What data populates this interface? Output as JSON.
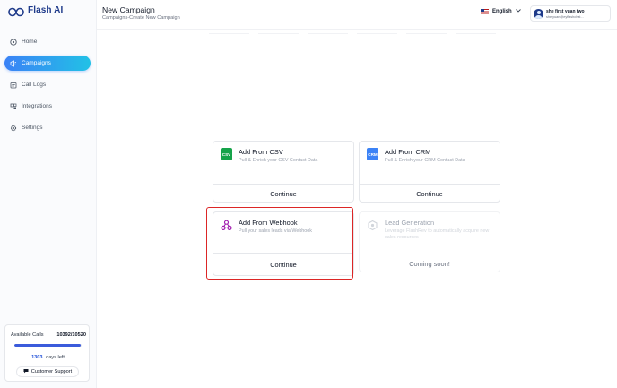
{
  "brand": {
    "name": "Flash AI",
    "accent": "#1e3a8a"
  },
  "sidebar": {
    "items": [
      {
        "label": "Home",
        "icon": "home-icon",
        "active": false
      },
      {
        "label": "Campaigns",
        "icon": "campaigns-icon",
        "active": true
      },
      {
        "label": "Call Logs",
        "icon": "call-logs-icon",
        "active": false
      },
      {
        "label": "Integrations",
        "icon": "integrations-icon",
        "active": false
      },
      {
        "label": "Settings",
        "icon": "gear-icon",
        "active": false
      }
    ],
    "usage": {
      "label": "Available Calls",
      "value": "10392/10520",
      "fraction": 0.988,
      "days_number": "1303",
      "days_label": "days left",
      "support_label": "Customer Support"
    }
  },
  "header": {
    "title": "New Campaign",
    "breadcrumb": "Campaigns-Create New Campaign",
    "language": "English",
    "user_name": "she first yuan two",
    "user_email": "she.yuan@eyflashchat..."
  },
  "cards": [
    {
      "title": "Add From CSV",
      "desc": "Pull & Enrich your CSV Contact Data",
      "button": "Continue",
      "badge": "CSV",
      "color": "#16a34a"
    },
    {
      "title": "Add From CRM",
      "desc": "Pull & Enrich your CRM Contact Data",
      "button": "Continue",
      "badge": "CRM",
      "color": "#3b82f6"
    },
    {
      "title": "Add From Webhook",
      "desc": "Pull your sales leads via Webhook",
      "button": "Continue",
      "icon": "webhook-icon",
      "color": "#a21caf"
    },
    {
      "title": "Lead Generation",
      "desc": "Leverage FlashRev to automatically acquire new sales resources",
      "button": "Coming soon!",
      "icon": "lead-generation-icon",
      "color": "#d1d5db"
    }
  ]
}
